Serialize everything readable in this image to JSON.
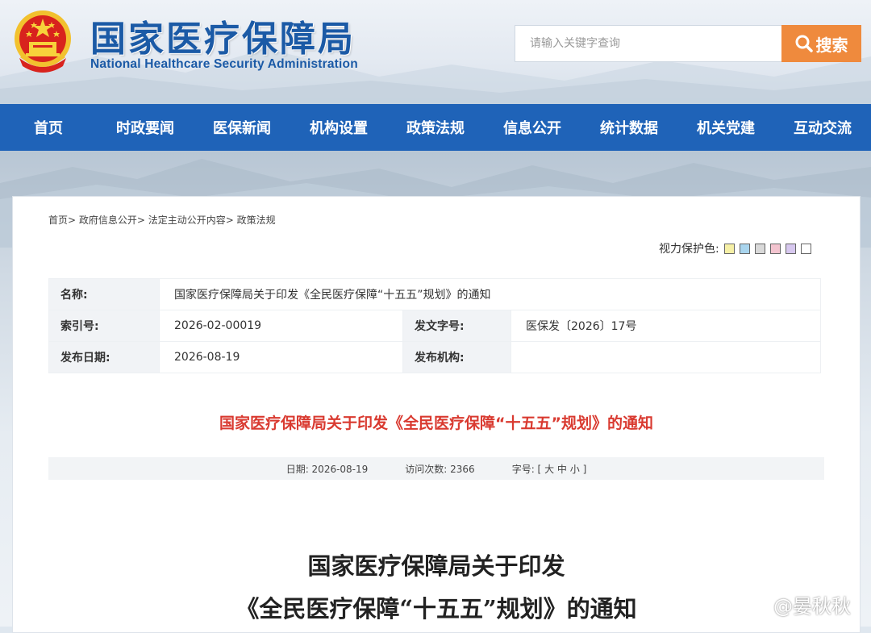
{
  "header": {
    "title": "国家医疗保障局",
    "subtitle": "National Healthcare Security Administration",
    "search_placeholder": "请输入关键字查询",
    "search_button": "搜索"
  },
  "nav": [
    "首页",
    "时政要闻",
    "医保新闻",
    "机构设置",
    "政策法规",
    "信息公开",
    "统计数据",
    "机关党建",
    "互动交流"
  ],
  "breadcrumb": [
    "首页>",
    "政府信息公开>",
    "法定主动公开内容>",
    "政策法规"
  ],
  "eye_protection": {
    "label": "视力保护色:",
    "swatches": [
      "#f6f0a6",
      "#a9d5ee",
      "#d9d9d9",
      "#f3c4cf",
      "#d7c8ef",
      "#ffffff"
    ]
  },
  "meta": {
    "name_label": "名称:",
    "name_value": "国家医疗保障局关于印发《全民医疗保障“十五五”规划》的通知",
    "index_label": "索引号:",
    "index_value": "2026-02-00019",
    "docno_label": "发文字号:",
    "docno_value": "医保发〔2026〕17号",
    "date_label": "发布日期:",
    "date_value": "2026-08-19",
    "org_label": "发布机构:",
    "org_value": ""
  },
  "red_title": "国家医疗保障局关于印发《全民医疗保障“十五五”规划》的通知",
  "info_bar": {
    "date": "日期: 2026-08-19",
    "visits": "访问次数: 2366",
    "fontsize_label": "字号: [",
    "fs_large": "大",
    "fs_medium": "中",
    "fs_small": "小",
    "fontsize_end": "]"
  },
  "doc_title": {
    "line1": "国家医疗保障局关于印发",
    "line2": "《全民医疗保障“十五五”规划》的通知"
  },
  "watermark": "@晏秋秋"
}
